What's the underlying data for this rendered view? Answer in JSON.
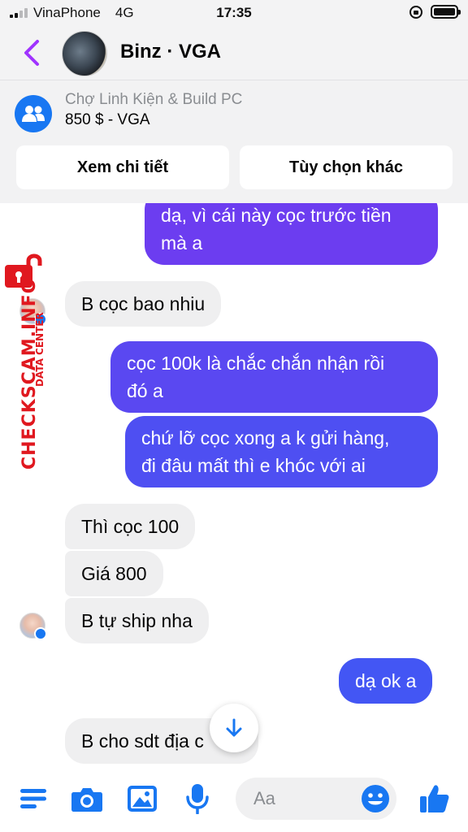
{
  "status_bar": {
    "carrier": "VinaPhone",
    "network": "4G",
    "time": "17:35",
    "battery_level": 1.0
  },
  "header": {
    "contact_name": "Binz · VGA"
  },
  "banner": {
    "group_name": "Chợ Linh Kiện & Build PC",
    "listing": "850 $ - VGA",
    "details_button": "Xem chi tiết",
    "options_button": "Tùy chọn khác"
  },
  "messages": [
    {
      "direction": "out",
      "lines": [
        "dạ, vì cái này cọc trước tiền",
        "mà a"
      ]
    },
    {
      "direction": "in",
      "text": "B cọc bao nhiu"
    },
    {
      "direction": "out",
      "lines": [
        "cọc 100k là chắc chắn nhận rồi",
        "đó a"
      ]
    },
    {
      "direction": "out",
      "lines": [
        "chứ lỡ cọc xong a k gửi hàng,",
        "đi đâu mất thì e khóc với ai"
      ]
    },
    {
      "direction": "in",
      "text": "Thì cọc 100"
    },
    {
      "direction": "in",
      "text": "Giá 800"
    },
    {
      "direction": "in",
      "text": "B tự ship nha"
    },
    {
      "direction": "out",
      "lines": [
        "dạ ok a"
      ]
    },
    {
      "direction": "in",
      "text": "B cho sdt địa c"
    }
  ],
  "watermark": {
    "site": "CHECKSCAM.INFO",
    "sub": "DATA CENTER"
  },
  "composer": {
    "placeholder": "Aa"
  },
  "icons": {
    "menu": "menu-icon",
    "camera": "camera-icon",
    "gallery": "image-icon",
    "microphone": "microphone-icon",
    "emoji": "emoji-icon",
    "like": "thumbs-up-icon",
    "back": "chevron-left-icon",
    "group": "group-icon",
    "scroll_down": "arrow-down-icon"
  },
  "colors": {
    "messenger_blue": "#1877f2",
    "outgoing_purple": "#6c3df0",
    "outgoing_blue": "#4356f4",
    "back_arrow": "#a033ff",
    "watermark_red": "#e0181f"
  }
}
